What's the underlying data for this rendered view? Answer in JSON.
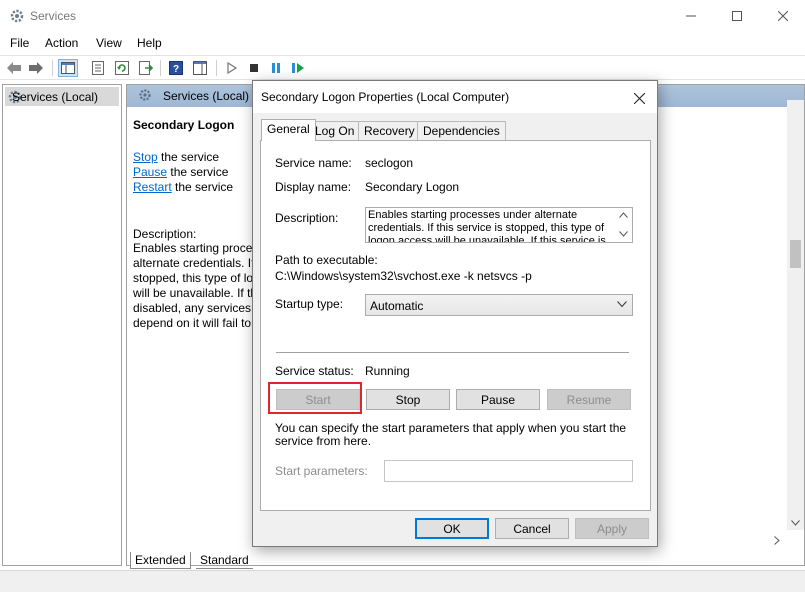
{
  "window": {
    "title": "Services",
    "icons": {
      "app": "gear-icon",
      "minimize": "minimize-icon",
      "maximize": "maximize-icon",
      "close": "close-icon"
    }
  },
  "menu": [
    "File",
    "Action",
    "View",
    "Help"
  ],
  "toolbar": {
    "icons": [
      "back-arrow-icon",
      "forward-arrow-icon",
      "show-console-tree-icon",
      "properties-icon",
      "refresh-icon",
      "export-list-icon",
      "help-icon",
      "show-action-pane-icon",
      "play-icon",
      "stop-icon",
      "pause-icon",
      "resume-icon"
    ],
    "accent": "#2a8fd7",
    "play_color": "#16a34a"
  },
  "tree": {
    "item": "Services (Local)"
  },
  "main": {
    "header": "Services (Local)",
    "service_name": "Secondary Logon",
    "actions": [
      {
        "link": "Stop",
        "rest": " the service"
      },
      {
        "link": "Pause",
        "rest": " the service"
      },
      {
        "link": "Restart",
        "rest": " the service"
      }
    ],
    "description_label": "Description:",
    "description_lines": [
      "Enables starting proces",
      "alternate credentials. If",
      "stopped, this type of lo",
      "will be unavailable. If th",
      "disabled, any services t",
      "depend on it will fail to"
    ]
  },
  "bottom_tabs": {
    "extended": "Extended",
    "standard": "Standard"
  },
  "dialog": {
    "title": "Secondary Logon Properties (Local Computer)",
    "tabs": [
      "General",
      "Log On",
      "Recovery",
      "Dependencies"
    ],
    "active_tab": "General",
    "service_name_label": "Service name:",
    "service_name_value": "seclogon",
    "display_name_label": "Display name:",
    "display_name_value": "Secondary Logon",
    "description_label": "Description:",
    "description_value": "Enables starting processes under alternate credentials. If this service is stopped, this type of logon access will be unavailable. If this service is",
    "path_label": "Path to executable:",
    "path_value": "C:\\Windows\\system32\\svchost.exe -k netsvcs -p",
    "startup_label": "Startup type:",
    "startup_value": "Automatic",
    "status_label": "Service status:",
    "status_value": "Running",
    "buttons": {
      "start": "Start",
      "stop": "Stop",
      "pause": "Pause",
      "resume": "Resume"
    },
    "hint": "You can specify the start parameters that apply when you start the service from here.",
    "params_label": "Start parameters:",
    "params_value": "",
    "footer": {
      "ok": "OK",
      "cancel": "Cancel",
      "apply": "Apply"
    }
  }
}
